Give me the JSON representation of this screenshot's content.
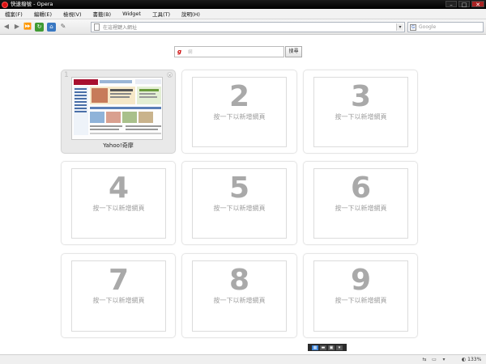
{
  "window": {
    "title": "快速撥號 - Opera",
    "minimize": "–",
    "maximize": "□",
    "close": "✕"
  },
  "menu": [
    "檔案(F)",
    "編輯(E)",
    "檢視(V)",
    "書籤(B)",
    "Widget",
    "工具(T)",
    "說明(H)"
  ],
  "toolbar": {
    "back": "◀",
    "forward": "▶",
    "fast_forward": "⏩",
    "reload": "↻",
    "home": "⌂",
    "wand": "✎",
    "address_placeholder": "在這裡鍵入網址",
    "search_engine_label": "Google",
    "search_engine_icon": "G",
    "dropdown": "▾"
  },
  "speed_dial": {
    "search": {
      "icon": "g",
      "placeholder": "網",
      "button": "搜尋"
    },
    "dials": [
      {
        "index": "1",
        "label": "Yahoo!奇摩",
        "filled": true,
        "close": "×"
      },
      {
        "number": "2",
        "hint": "按一下以新增網頁"
      },
      {
        "number": "3",
        "hint": "按一下以新增網頁"
      },
      {
        "number": "4",
        "hint": "按一下以新增網頁"
      },
      {
        "number": "5",
        "hint": "按一下以新增網頁"
      },
      {
        "number": "6",
        "hint": "按一下以新增網頁"
      },
      {
        "number": "7",
        "hint": "按一下以新增網頁"
      },
      {
        "number": "8",
        "hint": "按一下以新增網頁"
      },
      {
        "number": "9",
        "hint": "按一下以新增網頁"
      }
    ],
    "controls": [
      "▦",
      "▬",
      "▣",
      "▾"
    ]
  },
  "statusbar": {
    "icons": [
      "⇆",
      "▭",
      "▾"
    ],
    "zoom": "◐ 133%"
  }
}
